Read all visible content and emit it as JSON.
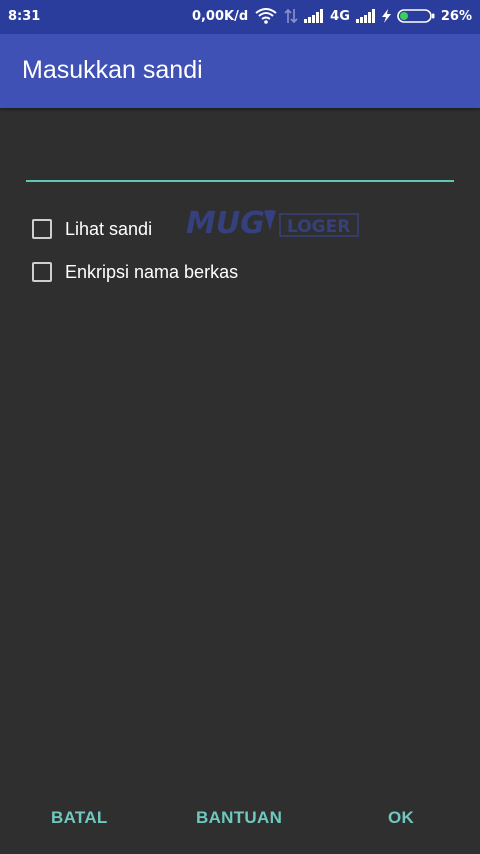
{
  "status_bar": {
    "time": "8:31",
    "network_speed": "0,00K/d",
    "network_type": "4G",
    "battery_percent": "26%",
    "battery_level": 0.26,
    "icons": [
      "wifi-icon",
      "data-arrows-icon",
      "signal-icon",
      "signal-icon",
      "charging-icon",
      "battery-icon"
    ]
  },
  "dialog": {
    "title": "Masukkan sandi",
    "password_value": "",
    "checkboxes": [
      {
        "label": "Lihat sandi",
        "checked": false
      },
      {
        "label": "Enkripsi nama berkas",
        "checked": false
      }
    ],
    "watermark_text": "MUGI LOGER",
    "buttons": {
      "cancel": "BATAL",
      "help": "BANTUAN",
      "ok": "OK"
    }
  },
  "colors": {
    "status_bar": "#2a3d9c",
    "app_bar": "#3f51b5",
    "background": "#2f2f2f",
    "accent": "#5ec8b4",
    "button_text": "#6fc9bf"
  }
}
